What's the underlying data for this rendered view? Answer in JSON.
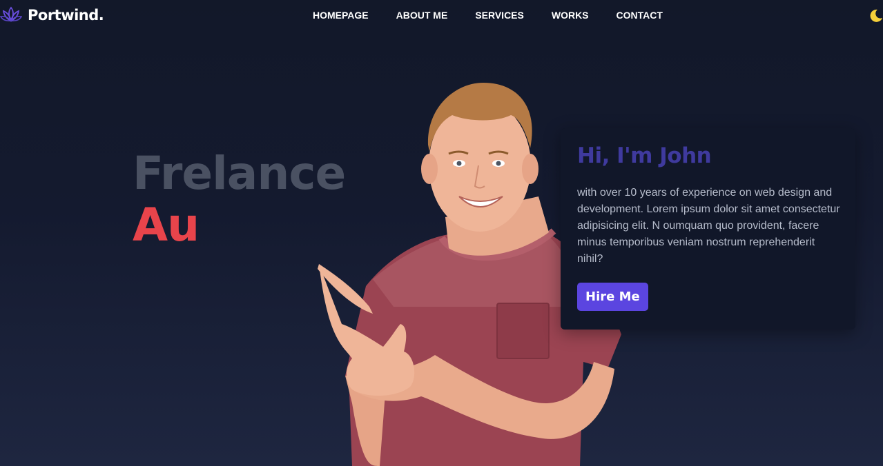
{
  "brand": {
    "name": "Portwind.",
    "logo_icon": "lotus-icon"
  },
  "nav": {
    "items": [
      {
        "label": "HOMEPAGE"
      },
      {
        "label": "ABOUT ME"
      },
      {
        "label": "SERVICES"
      },
      {
        "label": "WORKS"
      },
      {
        "label": "CONTACT"
      }
    ],
    "theme_icon": "moon-icon"
  },
  "hero": {
    "line1": "Frelance",
    "line2": "Au",
    "image": "smiling-man-pointing"
  },
  "card": {
    "title": "Hi, I'm John",
    "text": "with over 10 years of experience on web design and development. Lorem ipsum dolor sit amet consectetur adipisicing elit. N oumquam quo provident, facere minus temporibus veniam nostrum reprehenderit nihil?",
    "button": "Hire Me"
  },
  "colors": {
    "accent": "#5b45e0",
    "headline_muted": "#4a5162",
    "headline_red": "#e8444b",
    "card_title": "#3f3a9e",
    "moon": "#f5cf3a"
  }
}
